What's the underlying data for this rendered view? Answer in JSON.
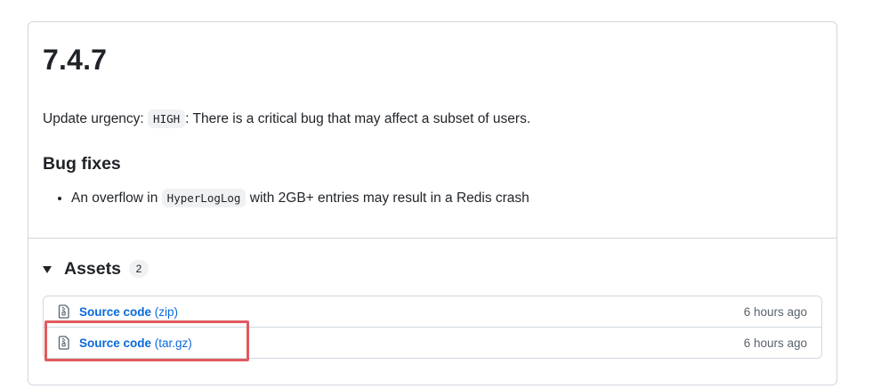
{
  "release": {
    "version": "7.4.7",
    "urgency_prefix": "Update urgency: ",
    "urgency_code": "HIGH",
    "urgency_text": ": There is a critical bug that may affect a subset of users.",
    "bug_fixes_heading": "Bug fixes",
    "bug_items": [
      {
        "prefix": "An overflow in ",
        "code": "HyperLogLog",
        "suffix": " with 2GB+ entries may result in a Redis crash"
      }
    ]
  },
  "assets": {
    "title": "Assets",
    "count": "2",
    "items": [
      {
        "name": "Source code",
        "ext": "(zip)",
        "time": "6 hours ago",
        "icon": "file-zip-icon"
      },
      {
        "name": "Source code",
        "ext": "(tar.gz)",
        "time": "6 hours ago",
        "icon": "file-zip-icon"
      }
    ]
  },
  "colors": {
    "link": "#0969da",
    "border": "#d0d7de",
    "highlight": "#e05a5f"
  }
}
